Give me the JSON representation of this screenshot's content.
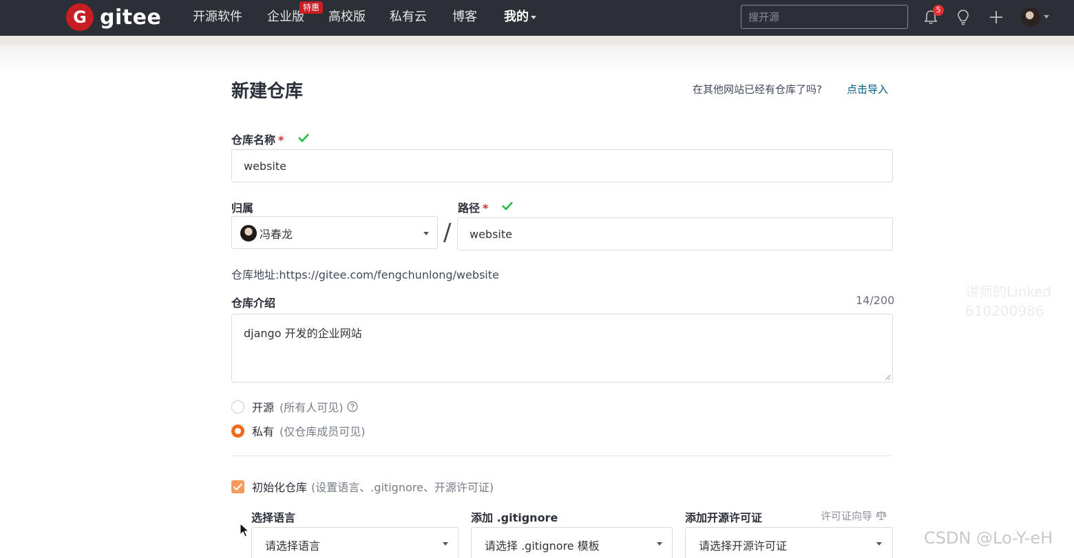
{
  "navbar": {
    "logo_mark": "G",
    "logo_text": "gitee",
    "items": [
      {
        "label": "开源软件"
      },
      {
        "label": "企业版"
      },
      {
        "label": "高校版"
      },
      {
        "label": "私有云"
      },
      {
        "label": "博客"
      },
      {
        "label": "我的"
      }
    ],
    "enterprise_badge": "特惠",
    "search_placeholder": "搜开源",
    "notification_count": "5"
  },
  "form": {
    "title": "新建仓库",
    "import_prompt": "在其他网站已经有仓库了吗?",
    "import_link": "点击导入",
    "repo_name_label": "仓库名称",
    "required_mark": "*",
    "repo_name_value": "website",
    "owner_label": "归属",
    "owner_value": "冯春龙",
    "path_label": "路径",
    "path_separator": "/",
    "path_value": "website",
    "repo_url_label": "仓库地址:",
    "repo_url_value": "https://gitee.com/fengchunlong/website",
    "description_label": "仓库介绍",
    "description_counter": "14/200",
    "description_value": "django 开发的企业网站",
    "visibility_public_label": "开源",
    "visibility_public_hint": "(所有人可见)",
    "visibility_private_label": "私有",
    "visibility_private_hint": "(仅仓库成员可见)",
    "visibility_selected": "私有",
    "init_repo_label": "初始化仓库",
    "init_repo_hint": "(设置语言、.gitignore、开源许可证)",
    "init_repo_checked": true,
    "language_label": "选择语言",
    "language_placeholder": "请选择语言",
    "gitignore_label": "添加 .gitignore",
    "gitignore_placeholder": "请选择 .gitignore 模板",
    "license_label": "添加开源许可证",
    "license_guide": "许可证向导",
    "license_placeholder": "请选择开源许可证"
  },
  "overlay": {
    "watermark_line1": "讲师的Linked",
    "watermark_line2": "610200986",
    "csdn_mark": "CSDN @Lo-Y-eH"
  },
  "colors": {
    "navbar_bg": "#2c2f36",
    "brand_red": "#c71d23",
    "link_blue": "#005980",
    "valid_green": "#21ba45",
    "radio_orange": "#f06a1e",
    "checkbox_orange": "#f59a5a"
  }
}
